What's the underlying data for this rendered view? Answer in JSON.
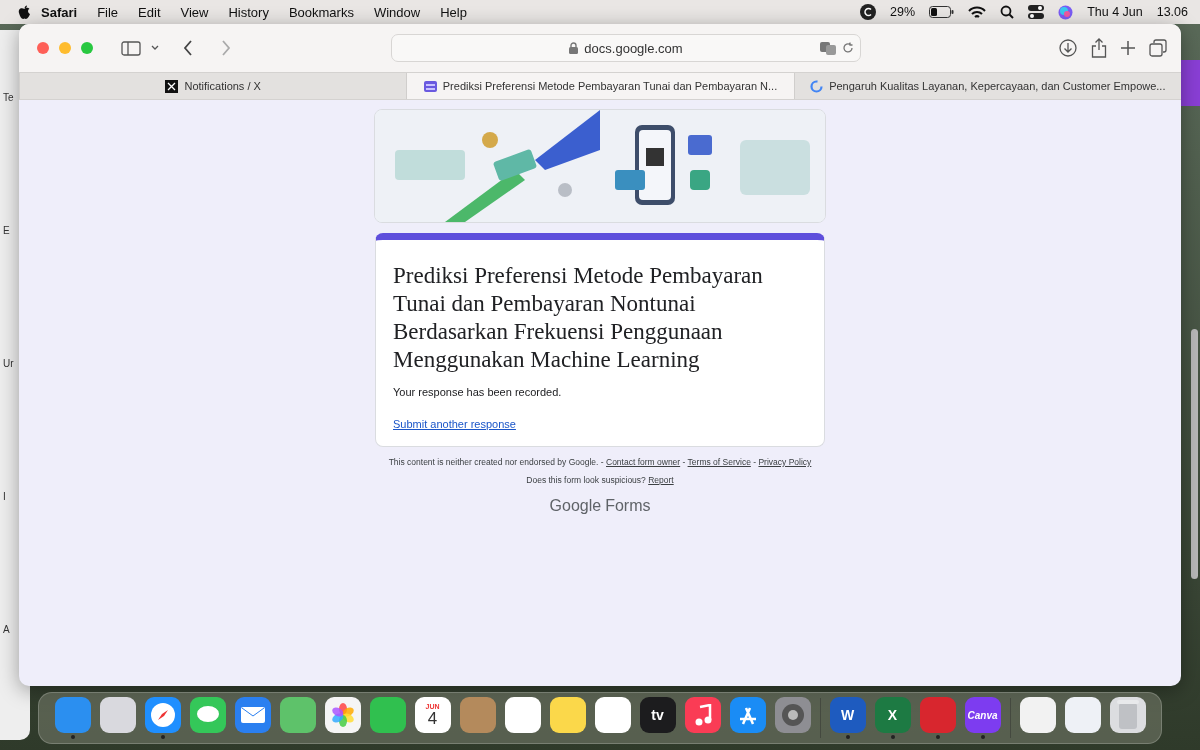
{
  "menu_bar": {
    "menus": [
      {
        "label": "Safari",
        "kind": "app"
      },
      {
        "label": "File",
        "kind": "menu"
      },
      {
        "label": "Edit",
        "kind": "menu"
      },
      {
        "label": "View",
        "kind": "menu"
      },
      {
        "label": "History",
        "kind": "menu"
      },
      {
        "label": "Bookmarks",
        "kind": "menu"
      },
      {
        "label": "Window",
        "kind": "menu"
      },
      {
        "label": "Help",
        "kind": "menu"
      }
    ],
    "battery": "29%",
    "date": "Thu 4 Jun",
    "time": "13.06"
  },
  "background_window": {
    "fragments": [
      "Te",
      "E",
      "Ur",
      "I",
      "A"
    ]
  },
  "browser": {
    "address": "docs.google.com",
    "tabs": [
      {
        "label": "Notifications / X",
        "kind": "x",
        "selected": false
      },
      {
        "label": "Prediksi Preferensi Metode Pembayaran Tunai dan Pembayaran N...",
        "kind": "forms",
        "selected": true
      },
      {
        "label": "Pengaruh Kualitas Layanan, Kepercayaan, dan Customer Empowe...",
        "kind": "google",
        "selected": false
      }
    ]
  },
  "form": {
    "title": "Prediksi Preferensi Metode Pembayaran Tunai dan Pembayaran Nontunai Berdasarkan Frekuensi Penggunaan Menggunakan Machine Learning",
    "message": "Your response has been recorded.",
    "link": "Submit another response"
  },
  "footer": {
    "notice": [
      {
        "kind": "text",
        "text": "This content is neither created nor endorsed by Google. - "
      },
      {
        "kind": "link",
        "text": "Contact form owner"
      },
      {
        "kind": "text",
        "text": " - "
      },
      {
        "kind": "link",
        "text": "Terms of Service"
      },
      {
        "kind": "text",
        "text": " - "
      },
      {
        "kind": "link",
        "text": "Privacy Policy"
      }
    ],
    "question": [
      {
        "kind": "text",
        "text": "Does this form look suspicious? "
      },
      {
        "kind": "link",
        "text": "Report"
      }
    ],
    "brand": "Google",
    "product": "Forms"
  },
  "dock": {
    "items": [
      {
        "kind": "finder",
        "color": "#2b8ff0",
        "running": true
      },
      {
        "kind": "launchpad",
        "color": "#d9d9de",
        "running": false
      },
      {
        "kind": "safari",
        "color": "#1f8fff",
        "running": true
      },
      {
        "kind": "messages",
        "color": "#34c759",
        "running": false
      },
      {
        "kind": "mail",
        "color": "#2a7ff0",
        "running": false
      },
      {
        "kind": "maps",
        "color": "#5ec26a",
        "running": false
      },
      {
        "kind": "photos",
        "color": "#f5f5f5",
        "running": false
      },
      {
        "kind": "facetime",
        "color": "#30c04f",
        "running": false
      },
      {
        "kind": "calendar",
        "color": "#ffffff",
        "running": false,
        "month": "JUN",
        "day": "4"
      },
      {
        "kind": "contacts",
        "color": "#b48a5c",
        "running": false
      },
      {
        "kind": "reminders",
        "color": "#ffffff",
        "running": false
      },
      {
        "kind": "notes",
        "color": "#fbd84a",
        "running": false
      },
      {
        "kind": "freeform",
        "color": "#ffffff",
        "running": false
      },
      {
        "kind": "tv",
        "color": "#1c1c1e",
        "running": false,
        "glyph": "tv"
      },
      {
        "kind": "music",
        "color": "#fa3c55",
        "running": false
      },
      {
        "kind": "appstore",
        "color": "#1a8cf5",
        "running": false
      },
      {
        "kind": "settings",
        "color": "#8e8e93",
        "running": false
      },
      {
        "kind": "separator"
      },
      {
        "kind": "word",
        "color": "#1e5bbf",
        "running": true,
        "glyph": "W"
      },
      {
        "kind": "excel",
        "color": "#1d7a43",
        "running": true,
        "glyph": "X"
      },
      {
        "kind": "mendeley",
        "color": "#d8262e",
        "running": true
      },
      {
        "kind": "canva",
        "color": "#7d3cf0",
        "running": true,
        "glyph": "Canva"
      },
      {
        "kind": "separator"
      },
      {
        "kind": "document",
        "color": "#f2f2f2",
        "running": false
      },
      {
        "kind": "window",
        "color": "#eef1f6",
        "running": false
      },
      {
        "kind": "trash",
        "color": "#dcdde0",
        "running": false
      }
    ]
  }
}
